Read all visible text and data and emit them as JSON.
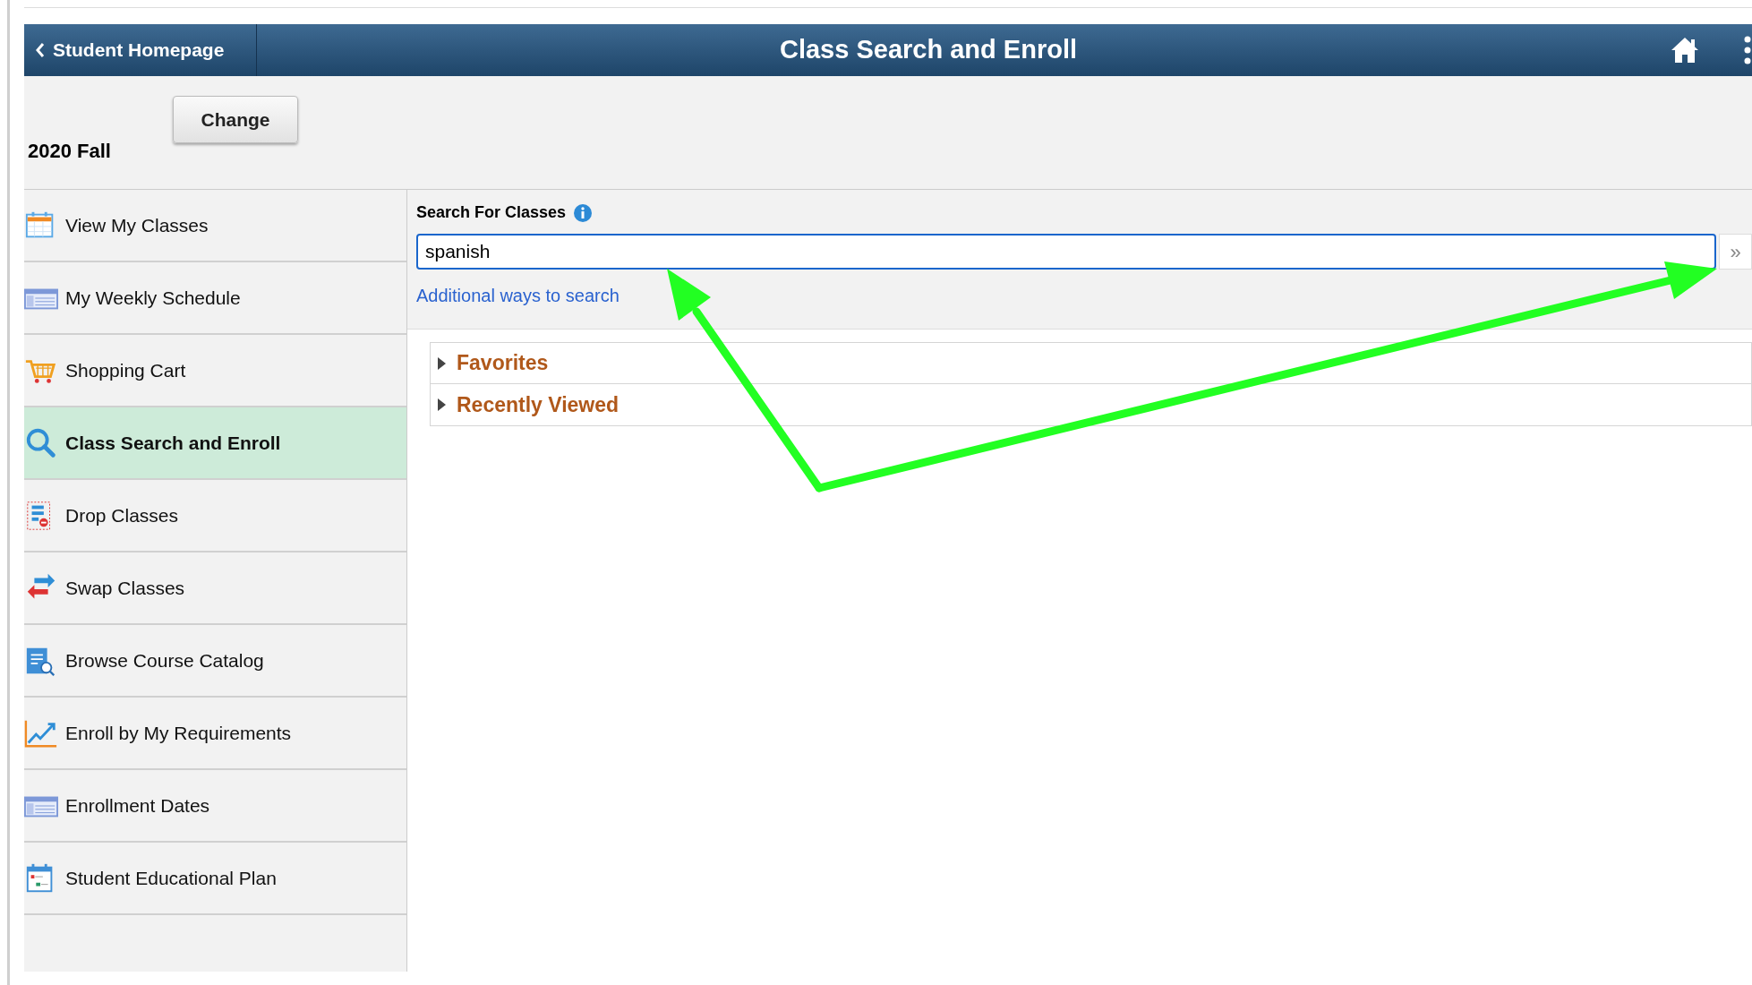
{
  "header": {
    "back_label": "Student Homepage",
    "title": "Class Search and Enroll"
  },
  "term": {
    "label": "2020 Fall",
    "button": "Change"
  },
  "sidebar": {
    "items": [
      {
        "label": "View My Classes",
        "kind": "calendar",
        "selected": false
      },
      {
        "label": "My Weekly Schedule",
        "kind": "schedule",
        "selected": false
      },
      {
        "label": "Shopping Cart",
        "kind": "cart",
        "selected": false
      },
      {
        "label": "Class Search and Enroll",
        "kind": "search",
        "selected": true
      },
      {
        "label": "Drop Classes",
        "kind": "drop",
        "selected": false
      },
      {
        "label": "Swap Classes",
        "kind": "swap",
        "selected": false
      },
      {
        "label": "Browse Course Catalog",
        "kind": "catalog",
        "selected": false
      },
      {
        "label": "Enroll by My Requirements",
        "kind": "chart",
        "selected": false
      },
      {
        "label": "Enrollment Dates",
        "kind": "schedule",
        "selected": false
      },
      {
        "label": "Student Educational Plan",
        "kind": "plan",
        "selected": false
      }
    ]
  },
  "search": {
    "label": "Search For Classes",
    "value": "spanish",
    "go_button": "»",
    "link": "Additional ways to search"
  },
  "sections": [
    {
      "label": "Favorites",
      "expanded": false
    },
    {
      "label": "Recently Viewed",
      "expanded": false
    }
  ]
}
